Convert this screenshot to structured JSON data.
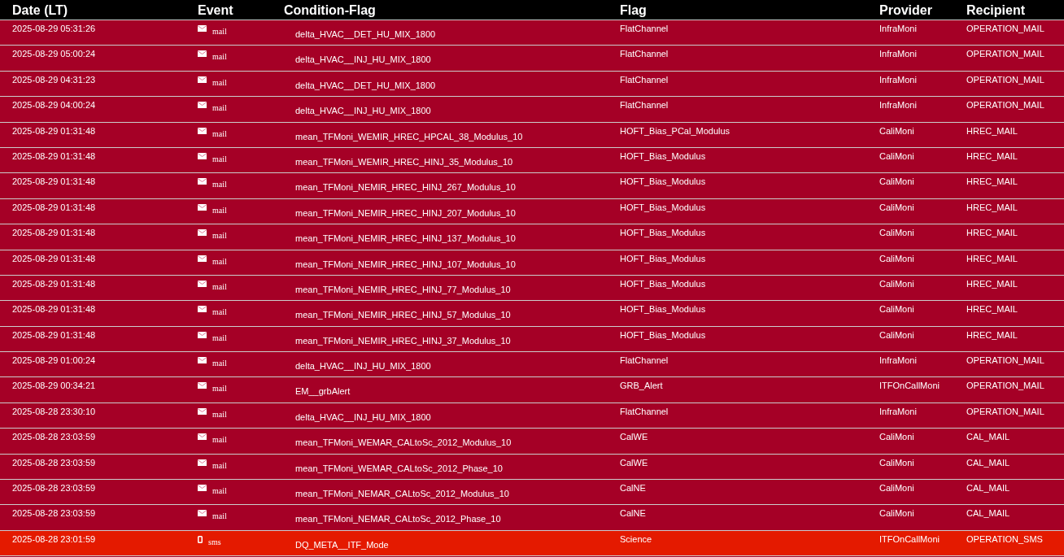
{
  "table": {
    "columns": [
      "Date (LT)",
      "Event",
      "Condition-Flag",
      "Flag",
      "Provider",
      "Recipient"
    ],
    "rows": [
      {
        "date": "2025-08-29 05:31:26",
        "kind": "mail",
        "event": "mail",
        "condition": "delta_HVAC__DET_HU_MIX_1800",
        "flag": "FlatChannel",
        "provider": "InfraMoni",
        "recipient": "OPERATION_MAIL"
      },
      {
        "date": "2025-08-29 05:00:24",
        "kind": "mail",
        "event": "mail",
        "condition": "delta_HVAC__INJ_HU_MIX_1800",
        "flag": "FlatChannel",
        "provider": "InfraMoni",
        "recipient": "OPERATION_MAIL"
      },
      {
        "date": "2025-08-29 04:31:23",
        "kind": "mail",
        "event": "mail",
        "condition": "delta_HVAC__DET_HU_MIX_1800",
        "flag": "FlatChannel",
        "provider": "InfraMoni",
        "recipient": "OPERATION_MAIL"
      },
      {
        "date": "2025-08-29 04:00:24",
        "kind": "mail",
        "event": "mail",
        "condition": "delta_HVAC__INJ_HU_MIX_1800",
        "flag": "FlatChannel",
        "provider": "InfraMoni",
        "recipient": "OPERATION_MAIL"
      },
      {
        "date": "2025-08-29 01:31:48",
        "kind": "mail",
        "event": "mail",
        "condition": "mean_TFMoni_WEMIR_HREC_HPCAL_38_Modulus_10",
        "flag": "HOFT_Bias_PCal_Modulus",
        "provider": "CaliMoni",
        "recipient": "HREC_MAIL"
      },
      {
        "date": "2025-08-29 01:31:48",
        "kind": "mail",
        "event": "mail",
        "condition": "mean_TFMoni_WEMIR_HREC_HINJ_35_Modulus_10",
        "flag": "HOFT_Bias_Modulus",
        "provider": "CaliMoni",
        "recipient": "HREC_MAIL"
      },
      {
        "date": "2025-08-29 01:31:48",
        "kind": "mail",
        "event": "mail",
        "condition": "mean_TFMoni_NEMIR_HREC_HINJ_267_Modulus_10",
        "flag": "HOFT_Bias_Modulus",
        "provider": "CaliMoni",
        "recipient": "HREC_MAIL"
      },
      {
        "date": "2025-08-29 01:31:48",
        "kind": "mail",
        "event": "mail",
        "condition": "mean_TFMoni_NEMIR_HREC_HINJ_207_Modulus_10",
        "flag": "HOFT_Bias_Modulus",
        "provider": "CaliMoni",
        "recipient": "HREC_MAIL"
      },
      {
        "date": "2025-08-29 01:31:48",
        "kind": "mail",
        "event": "mail",
        "condition": "mean_TFMoni_NEMIR_HREC_HINJ_137_Modulus_10",
        "flag": "HOFT_Bias_Modulus",
        "provider": "CaliMoni",
        "recipient": "HREC_MAIL"
      },
      {
        "date": "2025-08-29 01:31:48",
        "kind": "mail",
        "event": "mail",
        "condition": "mean_TFMoni_NEMIR_HREC_HINJ_107_Modulus_10",
        "flag": "HOFT_Bias_Modulus",
        "provider": "CaliMoni",
        "recipient": "HREC_MAIL"
      },
      {
        "date": "2025-08-29 01:31:48",
        "kind": "mail",
        "event": "mail",
        "condition": "mean_TFMoni_NEMIR_HREC_HINJ_77_Modulus_10",
        "flag": "HOFT_Bias_Modulus",
        "provider": "CaliMoni",
        "recipient": "HREC_MAIL"
      },
      {
        "date": "2025-08-29 01:31:48",
        "kind": "mail",
        "event": "mail",
        "condition": "mean_TFMoni_NEMIR_HREC_HINJ_57_Modulus_10",
        "flag": "HOFT_Bias_Modulus",
        "provider": "CaliMoni",
        "recipient": "HREC_MAIL"
      },
      {
        "date": "2025-08-29 01:31:48",
        "kind": "mail",
        "event": "mail",
        "condition": "mean_TFMoni_NEMIR_HREC_HINJ_37_Modulus_10",
        "flag": "HOFT_Bias_Modulus",
        "provider": "CaliMoni",
        "recipient": "HREC_MAIL"
      },
      {
        "date": "2025-08-29 01:00:24",
        "kind": "mail",
        "event": "mail",
        "condition": "delta_HVAC__INJ_HU_MIX_1800",
        "flag": "FlatChannel",
        "provider": "InfraMoni",
        "recipient": "OPERATION_MAIL"
      },
      {
        "date": "2025-08-29 00:34:21",
        "kind": "mail",
        "event": "mail",
        "condition": "EM__grbAlert",
        "flag": "GRB_Alert",
        "provider": "ITFOnCallMoni",
        "recipient": "OPERATION_MAIL"
      },
      {
        "date": "2025-08-28 23:30:10",
        "kind": "mail",
        "event": "mail",
        "condition": "delta_HVAC__INJ_HU_MIX_1800",
        "flag": "FlatChannel",
        "provider": "InfraMoni",
        "recipient": "OPERATION_MAIL"
      },
      {
        "date": "2025-08-28 23:03:59",
        "kind": "mail",
        "event": "mail",
        "condition": "mean_TFMoni_WEMAR_CALtoSc_2012_Modulus_10",
        "flag": "CalWE",
        "provider": "CaliMoni",
        "recipient": "CAL_MAIL"
      },
      {
        "date": "2025-08-28 23:03:59",
        "kind": "mail",
        "event": "mail",
        "condition": "mean_TFMoni_WEMAR_CALtoSc_2012_Phase_10",
        "flag": "CalWE",
        "provider": "CaliMoni",
        "recipient": "CAL_MAIL"
      },
      {
        "date": "2025-08-28 23:03:59",
        "kind": "mail",
        "event": "mail",
        "condition": "mean_TFMoni_NEMAR_CALtoSc_2012_Modulus_10",
        "flag": "CalNE",
        "provider": "CaliMoni",
        "recipient": "CAL_MAIL"
      },
      {
        "date": "2025-08-28 23:03:59",
        "kind": "mail",
        "event": "mail",
        "condition": "mean_TFMoni_NEMAR_CALtoSc_2012_Phase_10",
        "flag": "CalNE",
        "provider": "CaliMoni",
        "recipient": "CAL_MAIL"
      },
      {
        "date": "2025-08-28 23:01:59",
        "kind": "sms",
        "event": "sms",
        "condition": "DQ_META__ITF_Mode",
        "flag": "Science",
        "provider": "ITFOnCallMoni",
        "recipient": "OPERATION_SMS"
      }
    ]
  }
}
